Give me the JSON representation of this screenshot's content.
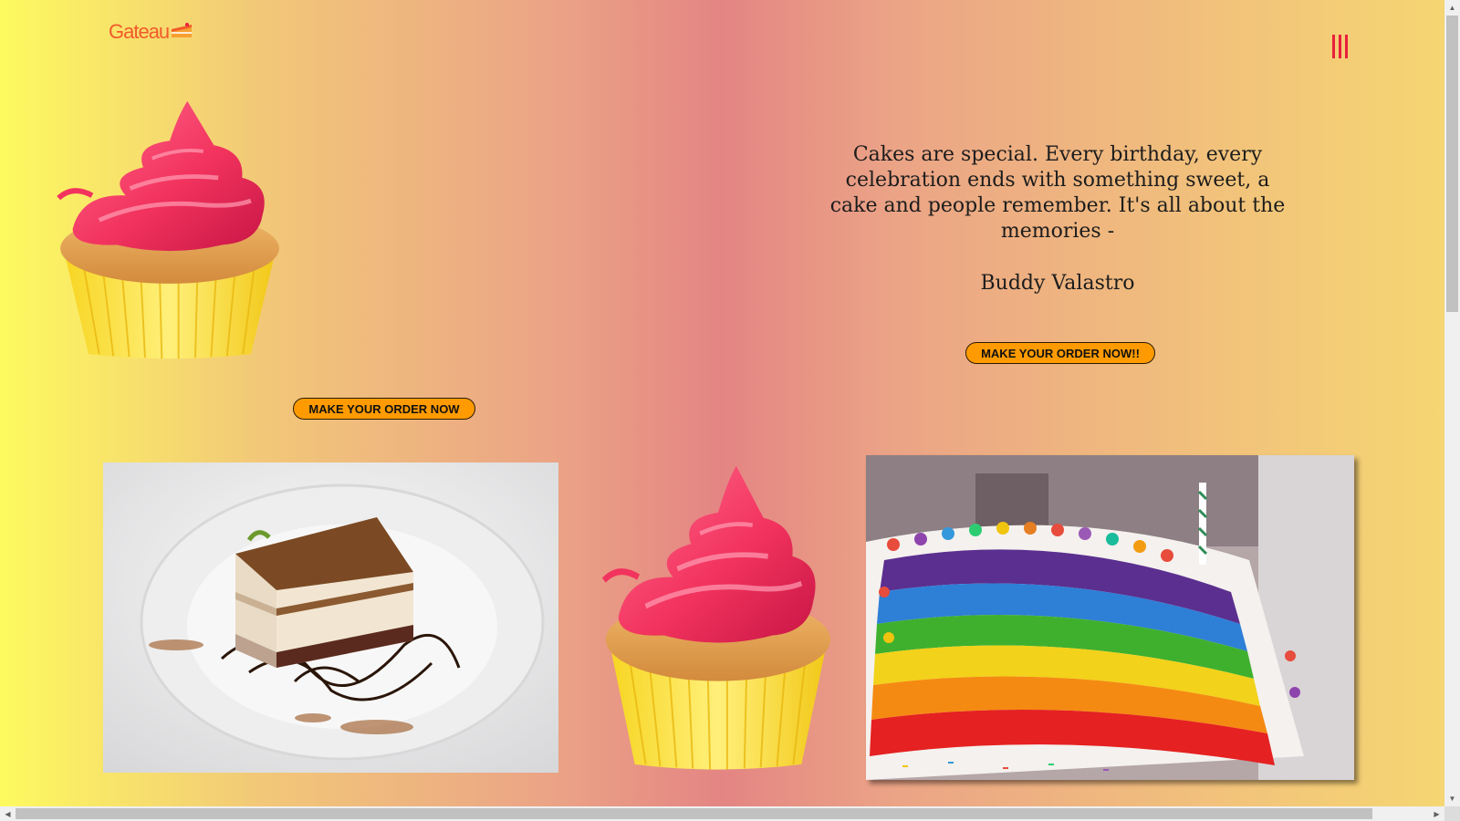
{
  "header": {
    "logo_text": "Gateau",
    "logo_icon": "cake-slice-icon",
    "menu_icon": "hamburger-menu-icon",
    "logo_color": "#f25a2b",
    "menu_color": "#e8203b"
  },
  "hero": {
    "order_button": "MAKE YOUR ORDER NOW",
    "quote": "Cakes are special. Every birthday, every celebration ends with something sweet, a cake and people remember. It's all about the memories -",
    "author": "Buddy Valastro",
    "quote_button": "MAKE YOUR ORDER NOW!!"
  },
  "gallery": {
    "images": [
      "tiramisu-slice-on-plate",
      "cupcake-pink-frosting",
      "rainbow-layer-cake"
    ]
  },
  "theme": {
    "button_color": "#ff9b00",
    "gradient_colors": [
      "#fdfa5f",
      "#e48583",
      "#f5d672"
    ]
  }
}
